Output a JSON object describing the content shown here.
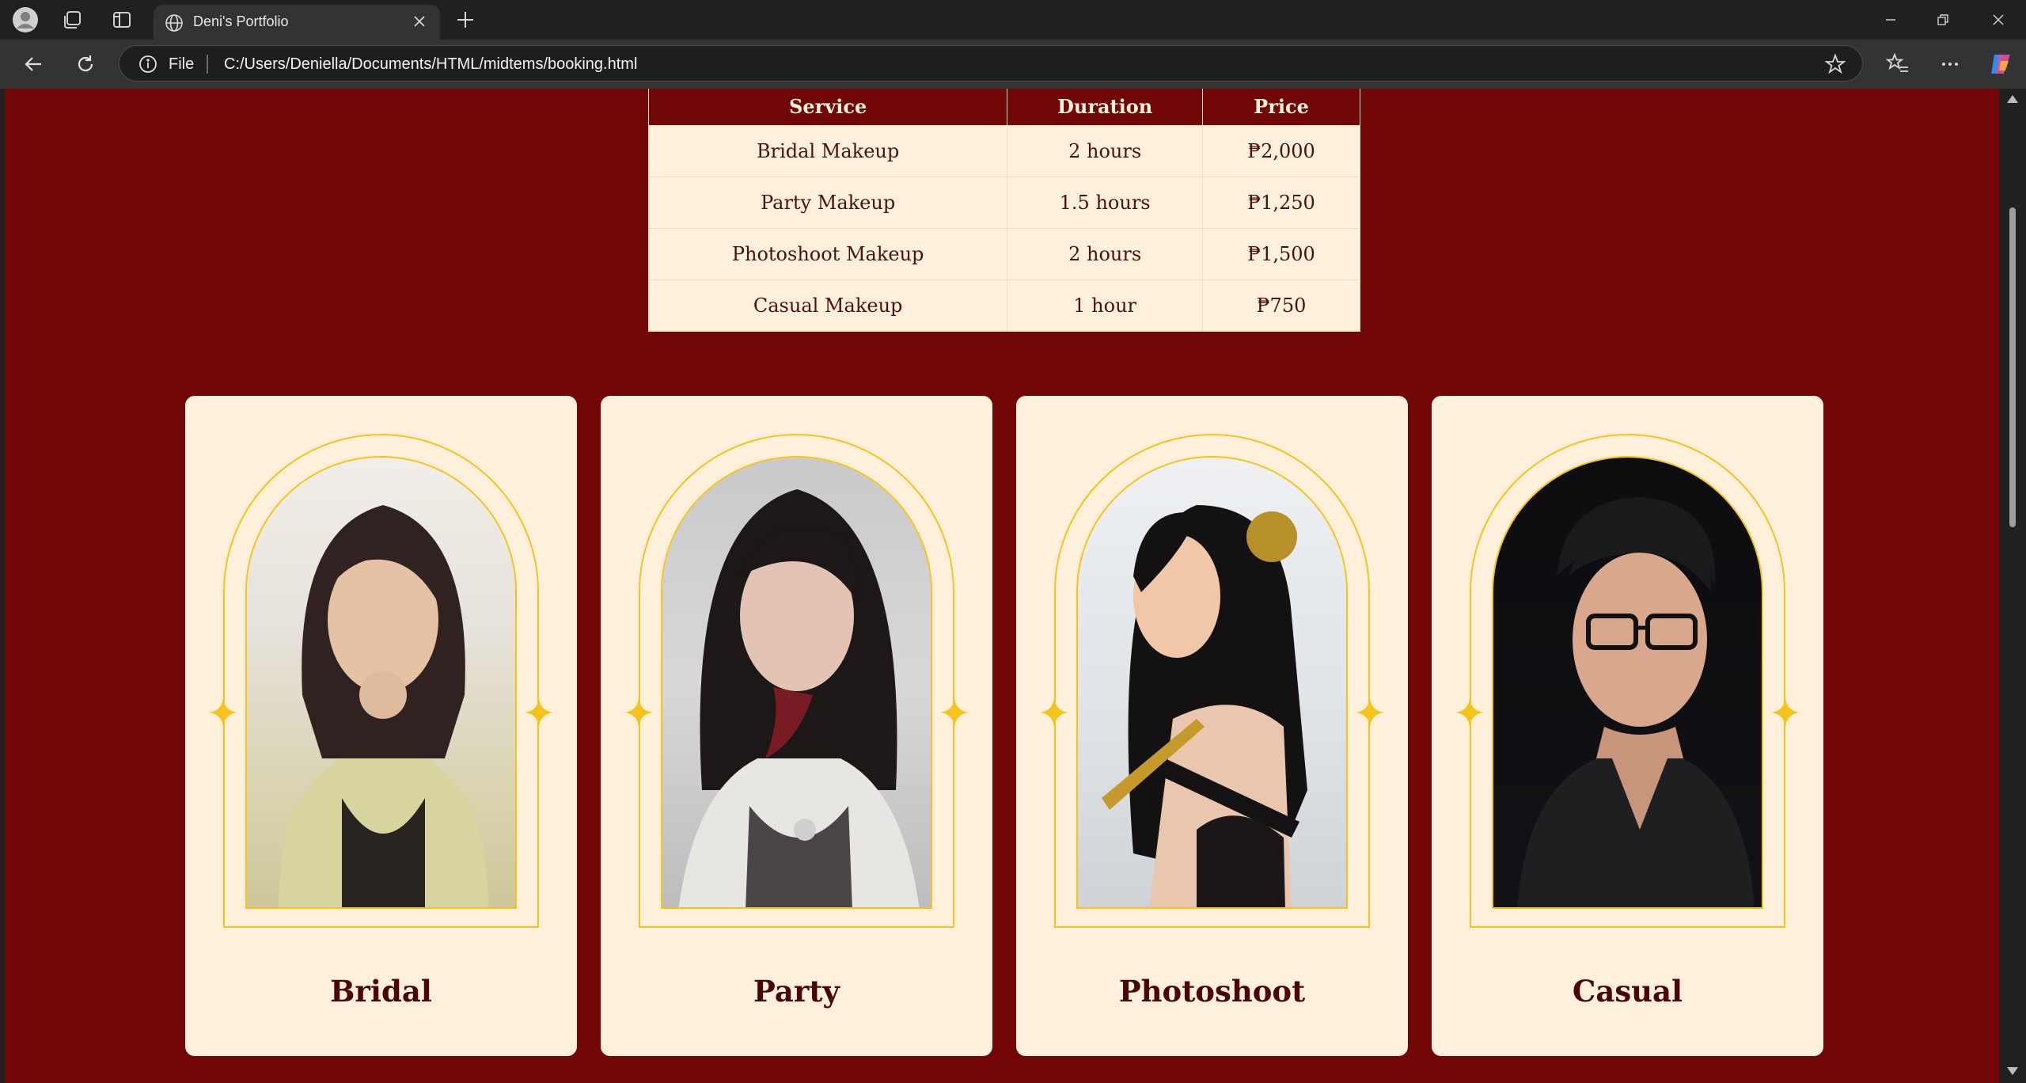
{
  "browser": {
    "tab_title": "Deni's Portfolio",
    "address_scheme_label": "File",
    "url": "C:/Users/Deniella/Documents/HTML/midtems/booking.html"
  },
  "page": {
    "table": {
      "headers": [
        "Service",
        "Duration",
        "Price"
      ],
      "rows": [
        [
          "Bridal Makeup",
          "2 hours",
          "₱2,000"
        ],
        [
          "Party Makeup",
          "1.5 hours",
          "₱1,250"
        ],
        [
          "Photoshoot Makeup",
          "2 hours",
          "₱1,500"
        ],
        [
          "Casual Makeup",
          "1 hour",
          "₱750"
        ]
      ]
    },
    "cards": [
      {
        "label": "Bridal"
      },
      {
        "label": "Party"
      },
      {
        "label": "Photoshoot"
      },
      {
        "label": "Casual"
      }
    ]
  },
  "colors": {
    "page_background": "#710606",
    "card_background": "#fff0dc",
    "accent_gold": "#f6c31a",
    "label_text": "#4a0606"
  }
}
